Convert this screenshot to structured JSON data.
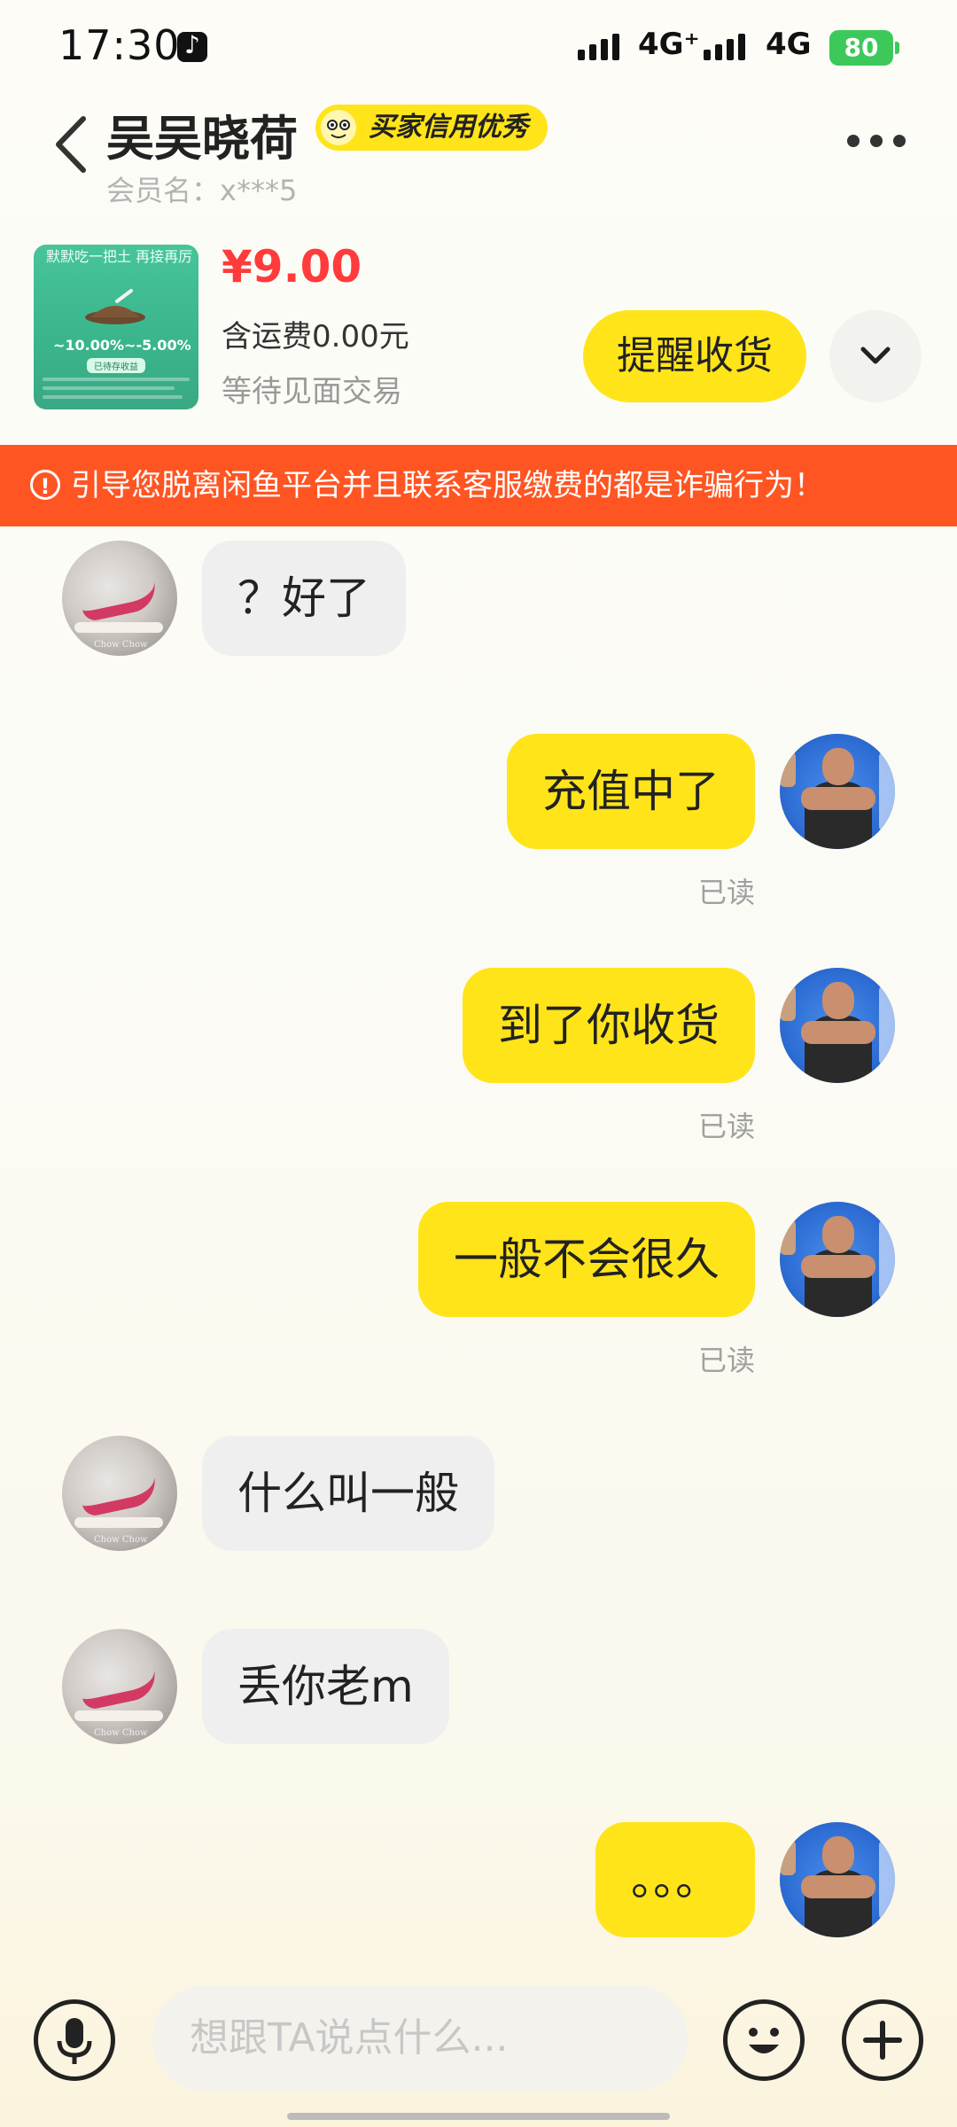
{
  "status_bar": {
    "time": "17:30",
    "network_1": "4G⁺",
    "network_2": "4G",
    "battery": "80"
  },
  "header": {
    "title": "吴吴晓荷",
    "credit_badge": "买家信用优秀",
    "member_name": "会员名：x***5"
  },
  "product": {
    "price": "¥9.00",
    "shipping": "含运费0.00元",
    "status": "等待见面交易",
    "remind_button": "提醒收货",
    "thumb_text": "默默吃一把土 再接再厉",
    "thumb_percent": "~10.00%~-5.00%",
    "thumb_tag": "已待存收益"
  },
  "warning": {
    "text": "引导您脱离闲鱼平台并且联系客服缴费的都是诈骗行为！"
  },
  "messages": [
    {
      "side": "in",
      "text": "？好了"
    },
    {
      "side": "out",
      "text": "充值中了",
      "status": "已读"
    },
    {
      "side": "out",
      "text": "到了你收货",
      "status": "已读"
    },
    {
      "side": "out",
      "text": "一般不会很久",
      "status": "已读"
    },
    {
      "side": "in",
      "text": "什么叫一般"
    },
    {
      "side": "in",
      "text": "丢你老m"
    },
    {
      "side": "out",
      "text": "。。。"
    }
  ],
  "input": {
    "placeholder": "想跟TA说点什么..."
  },
  "avatar_caption": "Chow Chow",
  "colors": {
    "accent_yellow": "#ffe41a",
    "warning_orange": "#ff5523",
    "price_red": "#ff3b3b",
    "battery_green": "#3dc95a"
  },
  "icons": [
    "back-icon",
    "more-icon",
    "chevron-down-icon",
    "alert-icon",
    "microphone-icon",
    "emoji-icon",
    "plus-icon"
  ]
}
